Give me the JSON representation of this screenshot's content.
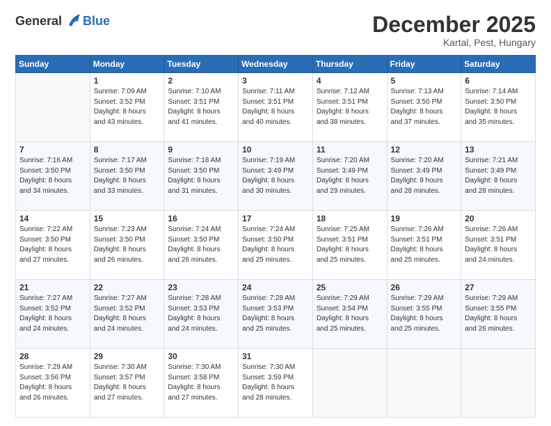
{
  "logo": {
    "line1": "General",
    "line2": "Blue"
  },
  "title": "December 2025",
  "subtitle": "Kartal, Pest, Hungary",
  "weekdays": [
    "Sunday",
    "Monday",
    "Tuesday",
    "Wednesday",
    "Thursday",
    "Friday",
    "Saturday"
  ],
  "weeks": [
    [
      {
        "num": "",
        "info": ""
      },
      {
        "num": "1",
        "info": "Sunrise: 7:09 AM\nSunset: 3:52 PM\nDaylight: 8 hours\nand 43 minutes."
      },
      {
        "num": "2",
        "info": "Sunrise: 7:10 AM\nSunset: 3:51 PM\nDaylight: 8 hours\nand 41 minutes."
      },
      {
        "num": "3",
        "info": "Sunrise: 7:11 AM\nSunset: 3:51 PM\nDaylight: 8 hours\nand 40 minutes."
      },
      {
        "num": "4",
        "info": "Sunrise: 7:12 AM\nSunset: 3:51 PM\nDaylight: 8 hours\nand 38 minutes."
      },
      {
        "num": "5",
        "info": "Sunrise: 7:13 AM\nSunset: 3:50 PM\nDaylight: 8 hours\nand 37 minutes."
      },
      {
        "num": "6",
        "info": "Sunrise: 7:14 AM\nSunset: 3:50 PM\nDaylight: 8 hours\nand 35 minutes."
      }
    ],
    [
      {
        "num": "7",
        "info": "Sunrise: 7:16 AM\nSunset: 3:50 PM\nDaylight: 8 hours\nand 34 minutes."
      },
      {
        "num": "8",
        "info": "Sunrise: 7:17 AM\nSunset: 3:50 PM\nDaylight: 8 hours\nand 33 minutes."
      },
      {
        "num": "9",
        "info": "Sunrise: 7:18 AM\nSunset: 3:50 PM\nDaylight: 8 hours\nand 31 minutes."
      },
      {
        "num": "10",
        "info": "Sunrise: 7:19 AM\nSunset: 3:49 PM\nDaylight: 8 hours\nand 30 minutes."
      },
      {
        "num": "11",
        "info": "Sunrise: 7:20 AM\nSunset: 3:49 PM\nDaylight: 8 hours\nand 29 minutes."
      },
      {
        "num": "12",
        "info": "Sunrise: 7:20 AM\nSunset: 3:49 PM\nDaylight: 8 hours\nand 28 minutes."
      },
      {
        "num": "13",
        "info": "Sunrise: 7:21 AM\nSunset: 3:49 PM\nDaylight: 8 hours\nand 28 minutes."
      }
    ],
    [
      {
        "num": "14",
        "info": "Sunrise: 7:22 AM\nSunset: 3:50 PM\nDaylight: 8 hours\nand 27 minutes."
      },
      {
        "num": "15",
        "info": "Sunrise: 7:23 AM\nSunset: 3:50 PM\nDaylight: 8 hours\nand 26 minutes."
      },
      {
        "num": "16",
        "info": "Sunrise: 7:24 AM\nSunset: 3:50 PM\nDaylight: 8 hours\nand 26 minutes."
      },
      {
        "num": "17",
        "info": "Sunrise: 7:24 AM\nSunset: 3:50 PM\nDaylight: 8 hours\nand 25 minutes."
      },
      {
        "num": "18",
        "info": "Sunrise: 7:25 AM\nSunset: 3:51 PM\nDaylight: 8 hours\nand 25 minutes."
      },
      {
        "num": "19",
        "info": "Sunrise: 7:26 AM\nSunset: 3:51 PM\nDaylight: 8 hours\nand 25 minutes."
      },
      {
        "num": "20",
        "info": "Sunrise: 7:26 AM\nSunset: 3:51 PM\nDaylight: 8 hours\nand 24 minutes."
      }
    ],
    [
      {
        "num": "21",
        "info": "Sunrise: 7:27 AM\nSunset: 3:52 PM\nDaylight: 8 hours\nand 24 minutes."
      },
      {
        "num": "22",
        "info": "Sunrise: 7:27 AM\nSunset: 3:52 PM\nDaylight: 8 hours\nand 24 minutes."
      },
      {
        "num": "23",
        "info": "Sunrise: 7:28 AM\nSunset: 3:53 PM\nDaylight: 8 hours\nand 24 minutes."
      },
      {
        "num": "24",
        "info": "Sunrise: 7:28 AM\nSunset: 3:53 PM\nDaylight: 8 hours\nand 25 minutes."
      },
      {
        "num": "25",
        "info": "Sunrise: 7:29 AM\nSunset: 3:54 PM\nDaylight: 8 hours\nand 25 minutes."
      },
      {
        "num": "26",
        "info": "Sunrise: 7:29 AM\nSunset: 3:55 PM\nDaylight: 8 hours\nand 25 minutes."
      },
      {
        "num": "27",
        "info": "Sunrise: 7:29 AM\nSunset: 3:55 PM\nDaylight: 8 hours\nand 26 minutes."
      }
    ],
    [
      {
        "num": "28",
        "info": "Sunrise: 7:29 AM\nSunset: 3:56 PM\nDaylight: 8 hours\nand 26 minutes."
      },
      {
        "num": "29",
        "info": "Sunrise: 7:30 AM\nSunset: 3:57 PM\nDaylight: 8 hours\nand 27 minutes."
      },
      {
        "num": "30",
        "info": "Sunrise: 7:30 AM\nSunset: 3:58 PM\nDaylight: 8 hours\nand 27 minutes."
      },
      {
        "num": "31",
        "info": "Sunrise: 7:30 AM\nSunset: 3:59 PM\nDaylight: 8 hours\nand 28 minutes."
      },
      {
        "num": "",
        "info": ""
      },
      {
        "num": "",
        "info": ""
      },
      {
        "num": "",
        "info": ""
      }
    ]
  ]
}
